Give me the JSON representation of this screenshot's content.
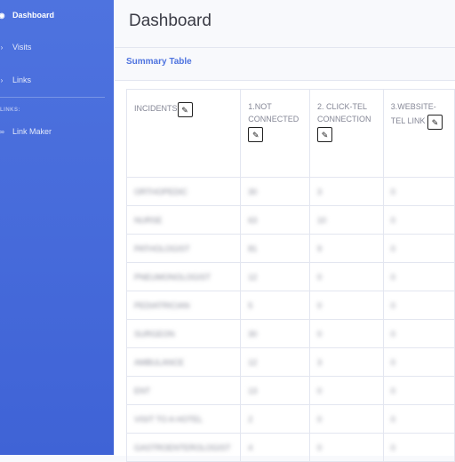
{
  "sidebar": {
    "items": [
      {
        "label": "Dashboard",
        "icon": "dashboard-icon"
      },
      {
        "label": "Visits",
        "icon": "chevron-icon"
      },
      {
        "label": "Links",
        "icon": "chevron-icon"
      }
    ],
    "section_heading": "LINKS:",
    "section_items": [
      {
        "label": "Link Maker",
        "icon": "link-icon"
      }
    ]
  },
  "page": {
    "title": "Dashboard"
  },
  "card": {
    "title": "Summary Table"
  },
  "table": {
    "headers": [
      "INCIDENTS",
      "1.NOT CONNECTED",
      "2. CLICK-TEL CONNECTION",
      "3.WEBSITE-TEL LINK"
    ],
    "edit_icon": "✎",
    "rows": [
      [
        "ORTHOPEDIC",
        "30",
        "3",
        "0"
      ],
      [
        "NURSE",
        "63",
        "10",
        "0"
      ],
      [
        "PATHOLOGIST",
        "81",
        "9",
        "0"
      ],
      [
        "PNEUMONOLOGIST",
        "12",
        "0",
        "0"
      ],
      [
        "PEDIATRICIAN",
        "5",
        "0",
        "0"
      ],
      [
        "SURGEON",
        "30",
        "0",
        "0"
      ],
      [
        "AMBULANCE",
        "12",
        "3",
        "0"
      ],
      [
        "ENT",
        "13",
        "0",
        "0"
      ],
      [
        "VISIT TO A HOTEL",
        "2",
        "0",
        "0"
      ],
      [
        "GASTROENTEROLOGIST",
        "4",
        "0",
        "0"
      ]
    ]
  }
}
